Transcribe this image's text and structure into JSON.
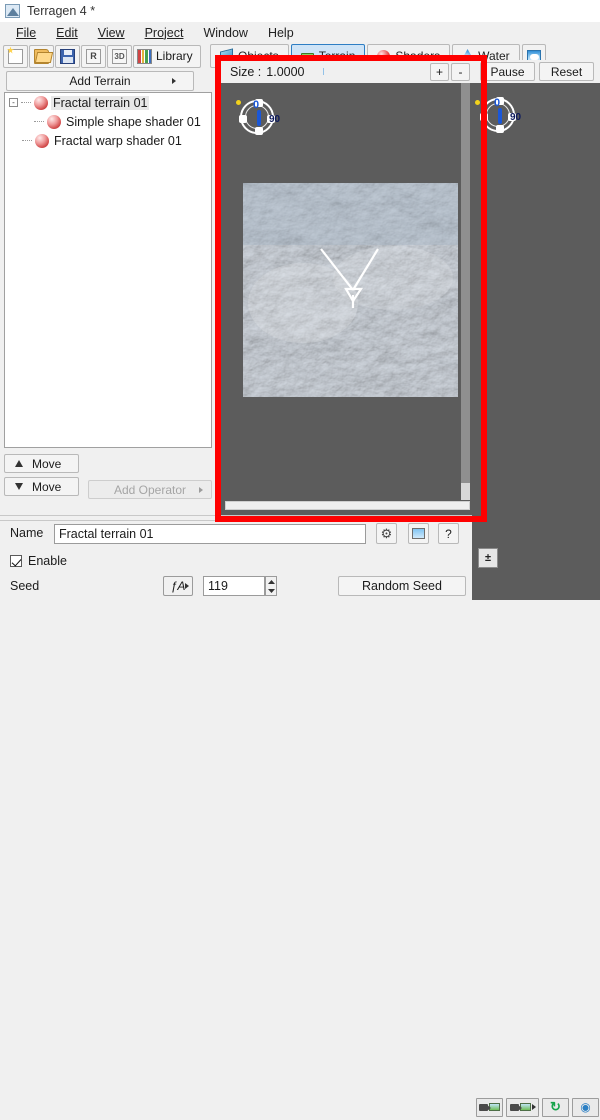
{
  "window": {
    "title": "Terragen 4 *",
    "logo_icon": "terragen-logo-icon"
  },
  "menubar": {
    "items": [
      {
        "label": "File"
      },
      {
        "label": "Edit"
      },
      {
        "label": "View"
      },
      {
        "label": "Project"
      },
      {
        "label": "Window"
      },
      {
        "label": "Help"
      }
    ]
  },
  "toolbar": {
    "buttons": [
      {
        "name": "new-project-button",
        "icon": "new-file-icon",
        "label": ""
      },
      {
        "name": "open-project-button",
        "icon": "open-folder-icon",
        "label": ""
      },
      {
        "name": "save-project-button",
        "icon": "save-disk-icon",
        "label": ""
      },
      {
        "name": "render-button",
        "icon": "render-r-icon",
        "label": "R"
      },
      {
        "name": "preview-3d-button",
        "icon": "3d-icon",
        "label": "3D"
      }
    ],
    "library_label": "Library"
  },
  "module_tabs": [
    {
      "label": "Objects",
      "icon": "objects-icon",
      "selected": false
    },
    {
      "label": "Terrain",
      "icon": "terrain-icon",
      "selected": true
    },
    {
      "label": "Shaders",
      "icon": "shaders-sphere-icon",
      "selected": false
    },
    {
      "label": "Water",
      "icon": "water-drop-icon",
      "selected": false
    },
    {
      "label": "",
      "icon": "atmosphere-cloud-icon",
      "selected": false
    }
  ],
  "left_panel": {
    "add_terrain_label": "Add Terrain",
    "tree": [
      {
        "label": "Fractal terrain 01",
        "depth": 0,
        "selected": true,
        "expander": "-"
      },
      {
        "label": "Simple shape shader 01",
        "depth": 1,
        "selected": false,
        "expander": ""
      },
      {
        "label": "Fractal warp shader 01",
        "depth": 0,
        "selected": false,
        "expander": ""
      }
    ],
    "move_up_label": "Move",
    "move_down_label": "Move",
    "add_operator_label": "Add Operator"
  },
  "preview": {
    "size_label": "Size :",
    "size_value": "1.0000",
    "zoom_in_label": "+",
    "zoom_out_label": "-",
    "pause_label": "Pause",
    "reset_label": "Reset",
    "compass_heading": "0",
    "compass_pitch": "90"
  },
  "properties": {
    "name_label": "Name",
    "name_value": "Fractal terrain 01",
    "enable_label": "Enable",
    "enable_checked": true,
    "seed_label": "Seed",
    "seed_value": "119",
    "function_button_label": "ƒA",
    "random_seed_label": "Random Seed",
    "settings_icon": "gear-icon",
    "color_icon": "color-swatch-icon",
    "help_icon": "question-mark-icon",
    "help_label": "?"
  },
  "bottom_right": {
    "exposure_icon": "exposure-icon",
    "exposure_label": "±",
    "render_to_preview_icon": "render-camera-icon",
    "render_options_icon": "render-camera-options-icon",
    "refresh_icon": "refresh-icon",
    "globe_icon": "globe-icon"
  },
  "annotation": {
    "highlight_color": "#ff0000",
    "shape": "rectangle"
  }
}
